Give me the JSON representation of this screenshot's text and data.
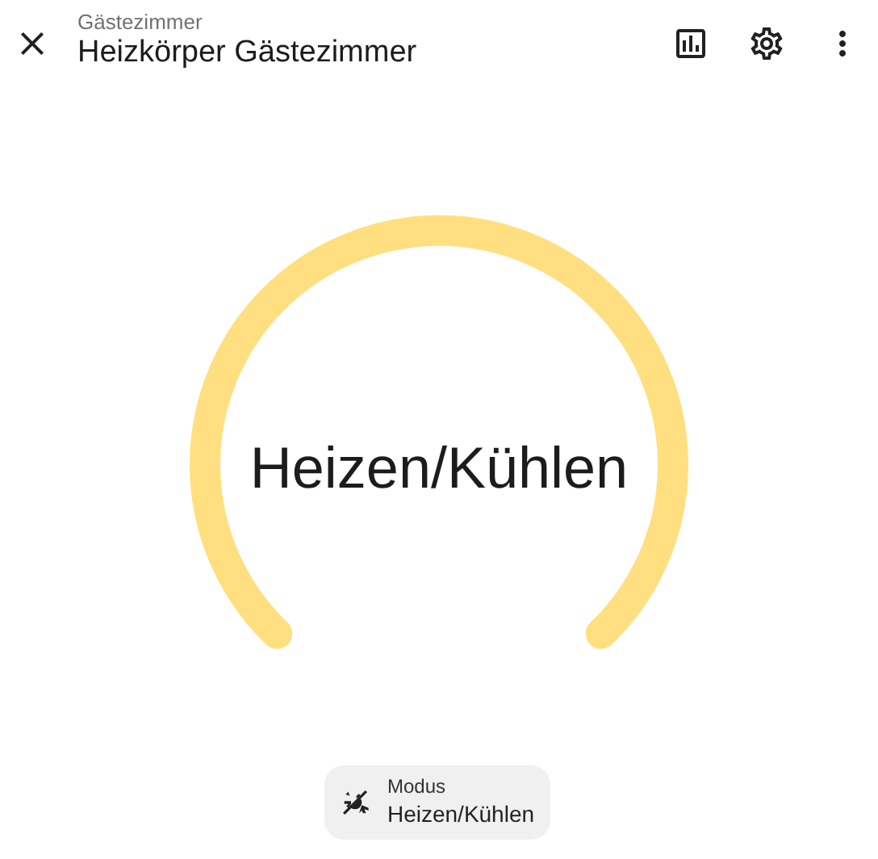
{
  "header": {
    "subtitle": "Gästezimmer",
    "title": "Heizkörper Gästezimmer"
  },
  "dial": {
    "label": "Heizen/Kühlen"
  },
  "mode_chip": {
    "label": "Modus",
    "value": "Heizen/Kühlen"
  }
}
